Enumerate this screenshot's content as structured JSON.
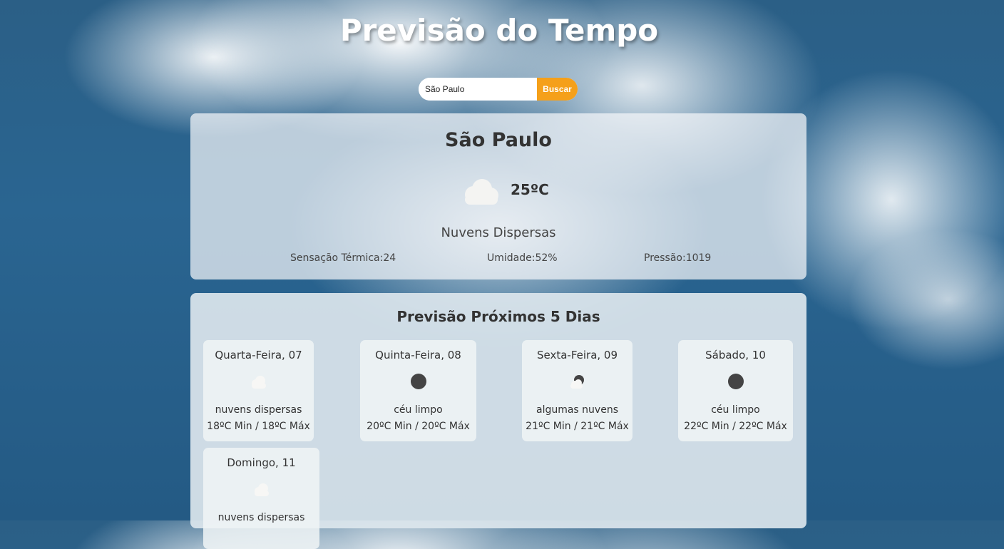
{
  "header": {
    "title": "Previsão do Tempo"
  },
  "search": {
    "value": "São Paulo",
    "button_label": "Buscar"
  },
  "current": {
    "city": "São Paulo",
    "temperature": "25ºC",
    "icon": "cloud-icon",
    "description": "Nuvens Dispersas",
    "feels_like": "Sensação Térmica:24",
    "humidity": "Umidade:52%",
    "pressure": "Pressão:1019"
  },
  "forecast": {
    "title": "Previsão Próximos 5 Dias",
    "days": [
      {
        "name": "Quarta-Feira, 07",
        "icon": "cloud-icon",
        "description": "nuvens dispersas",
        "range": "18ºC Min / 18ºC Máx"
      },
      {
        "name": "Quinta-Feira, 08",
        "icon": "clear-sky-icon",
        "description": "céu limpo",
        "range": "20ºC Min / 20ºC Máx"
      },
      {
        "name": "Sexta-Feira, 09",
        "icon": "few-clouds-icon",
        "description": "algumas nuvens",
        "range": "21ºC Min / 21ºC Máx"
      },
      {
        "name": "Sábado, 10",
        "icon": "clear-sky-icon",
        "description": "céu limpo",
        "range": "22ºC Min / 22ºC Máx"
      },
      {
        "name": "Domingo, 11",
        "icon": "cloud-icon",
        "description": "nuvens dispersas",
        "range": ""
      }
    ]
  },
  "colors": {
    "accent": "#f5a01a",
    "text": "#333333"
  }
}
